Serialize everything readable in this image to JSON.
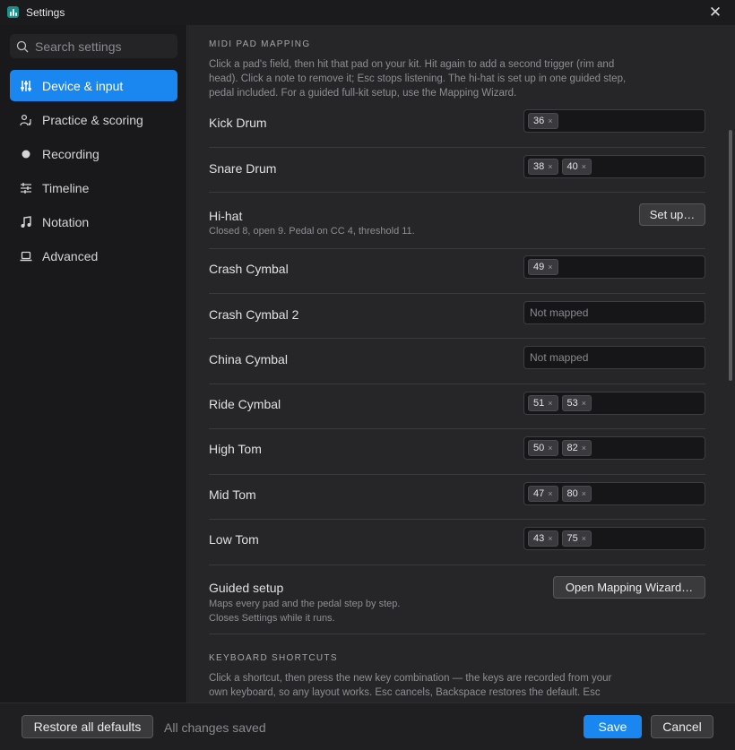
{
  "window": {
    "title": "Settings",
    "app_icon": "drum-app-icon",
    "close_icon": "close-icon",
    "close_glyph": "✕"
  },
  "sidebar": {
    "search": {
      "placeholder": "Search settings",
      "value": ""
    },
    "items": [
      {
        "label": "Device & input",
        "icon": "sliders-icon",
        "active": true
      },
      {
        "label": "Practice & scoring",
        "icon": "user-music-icon",
        "active": false
      },
      {
        "label": "Recording",
        "icon": "record-dot-icon",
        "active": false
      },
      {
        "label": "Timeline",
        "icon": "timeline-icon",
        "active": false
      },
      {
        "label": "Notation",
        "icon": "music-note-icon",
        "active": false
      },
      {
        "label": "Advanced",
        "icon": "laptop-icon",
        "active": false
      }
    ]
  },
  "midi": {
    "title": "MIDI PAD MAPPING",
    "description": "Click a pad's field, then hit that pad on your kit. Hit again to add a second trigger (rim and head). Click a note to remove it; Esc stops listening. The hi-hat is set up in one guided step, pedal included. For a guided full-kit setup, use the Mapping Wizard.",
    "rows": {
      "kick": {
        "label": "Kick Drum",
        "notes": [
          "36"
        ]
      },
      "snare": {
        "label": "Snare Drum",
        "notes": [
          "38",
          "40"
        ]
      },
      "hihat": {
        "label": "Hi-hat",
        "sub": "Closed 8, open 9. Pedal on CC 4, threshold 11.",
        "button": "Set up…"
      },
      "crash": {
        "label": "Crash Cymbal",
        "notes": [
          "49"
        ]
      },
      "crash2": {
        "label": "Crash Cymbal 2",
        "placeholder": "Not mapped"
      },
      "china": {
        "label": "China Cymbal",
        "placeholder": "Not mapped"
      },
      "ride": {
        "label": "Ride Cymbal",
        "notes": [
          "51",
          "53"
        ]
      },
      "hightom": {
        "label": "High Tom",
        "notes": [
          "50",
          "82"
        ]
      },
      "midtom": {
        "label": "Mid Tom",
        "notes": [
          "47",
          "80"
        ]
      },
      "lowtom": {
        "label": "Low Tom",
        "notes": [
          "43",
          "75"
        ]
      }
    },
    "remove_glyph": "×",
    "guided": {
      "label": "Guided setup",
      "sub1": "Maps every pad and the pedal step by step.",
      "sub2": "Closes Settings while it runs.",
      "button": "Open Mapping Wizard…"
    }
  },
  "shortcuts": {
    "title": "KEYBOARD SHORTCUTS",
    "description": "Click a shortcut, then press the new key combination — the keys are recorded from your own keyboard, so any layout works. Esc cancels, Backspace restores the default. Esc"
  },
  "footer": {
    "restore": "Restore all defaults",
    "status": "All changes saved",
    "save": "Save",
    "cancel": "Cancel"
  },
  "colors": {
    "accent": "#1a86ef",
    "app_icon": "#1d8f8a"
  }
}
